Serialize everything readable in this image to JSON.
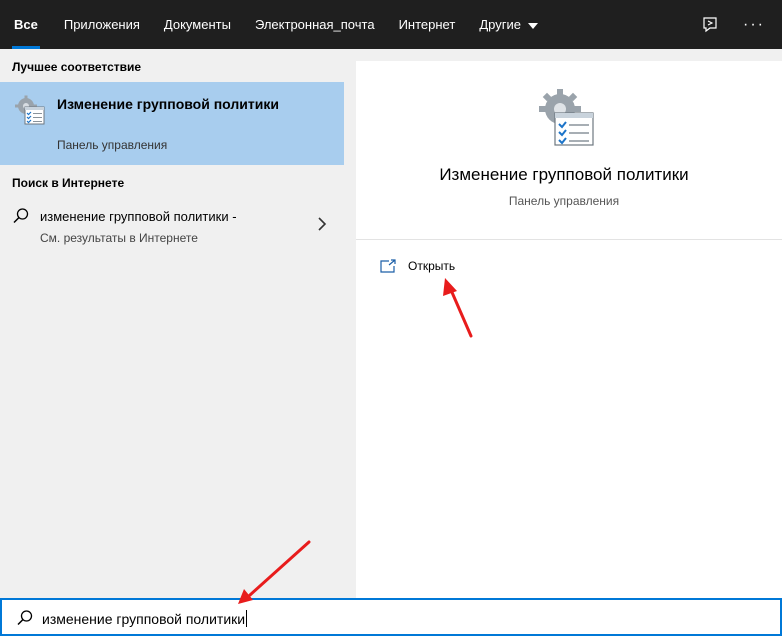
{
  "tabs": [
    {
      "label": "Все",
      "active": true
    },
    {
      "label": "Приложения"
    },
    {
      "label": "Документы"
    },
    {
      "label": "Электронная_почта"
    },
    {
      "label": "Интернет"
    },
    {
      "label": "Другие",
      "dropdown": true
    }
  ],
  "topbar_icons": [
    "feedback-icon",
    "more-options-icon"
  ],
  "more_label": "···",
  "left": {
    "best_match_header": "Лучшее соответствие",
    "best_match": {
      "title": "Изменение групповой политики",
      "subtitle": "Панель управления",
      "icon": "group-policy-icon"
    },
    "web_header": "Поиск в Интернете",
    "web_result": {
      "title": "изменение групповой политики -",
      "subtitle": "См. результаты в Интернете",
      "icon": "search-icon"
    }
  },
  "right": {
    "title": "Изменение групповой политики",
    "subtitle": "Панель управления",
    "action_open": "Открыть"
  },
  "search": {
    "value": "изменение групповой политики"
  },
  "colors": {
    "topbar": "#1f1f1f",
    "accent": "#0078d7",
    "selected": "#a8cdee",
    "annotation": "#e81c1c"
  }
}
